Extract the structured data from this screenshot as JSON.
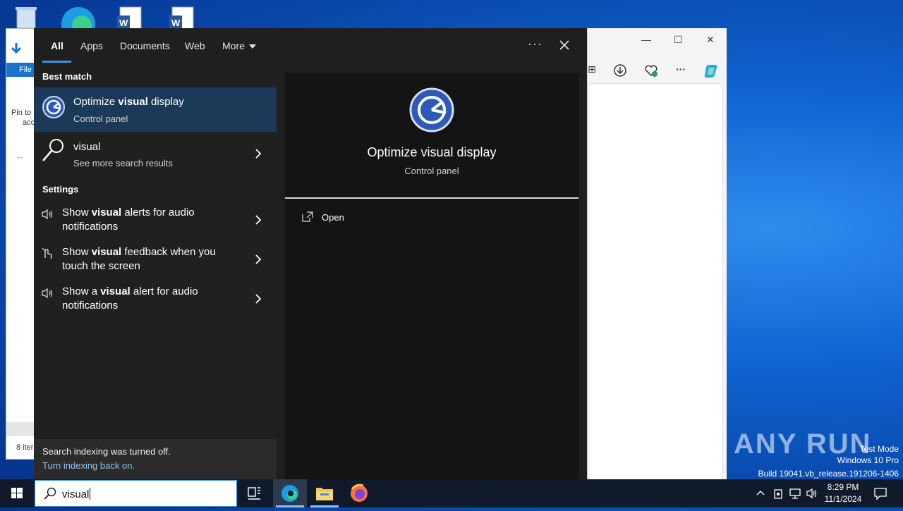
{
  "search_panel": {
    "tabs": [
      {
        "label": "All"
      },
      {
        "label": "Apps"
      },
      {
        "label": "Documents"
      },
      {
        "label": "Web"
      },
      {
        "label": "More"
      }
    ],
    "more_options": "···",
    "best_match_header": "Best match",
    "best_match": {
      "pre": "Optimize ",
      "bold": "visual",
      "post": " display",
      "subtitle": "Control panel",
      "icon": "ease-of-access-icon"
    },
    "web_result": {
      "title": "visual",
      "subtitle": "See more search results",
      "icon": "search-icon"
    },
    "settings_header": "Settings",
    "settings": [
      {
        "pre": "Show ",
        "bold": "visual",
        "line1_post": " alerts for audio",
        "line2": "notifications",
        "icon": "speaker-icon"
      },
      {
        "pre": "Show ",
        "bold": "visual",
        "line1_post": " feedback when you",
        "line2": "touch the screen",
        "icon": "touch-icon"
      },
      {
        "pre": "Show a ",
        "bold": "visual",
        "line1_post": " alert for audio",
        "line2": "notifications",
        "icon": "speaker-icon"
      }
    ],
    "footer": {
      "line1": "Search indexing was turned off.",
      "line2": "Turn indexing back on."
    },
    "preview": {
      "title": "Optimize visual display",
      "subtitle": "Control panel",
      "open_label": "Open"
    }
  },
  "taskbar": {
    "search_value": "visual",
    "time": "8:29 PM",
    "date": "11/1/2024"
  },
  "explorer_bg": {
    "file_tab": "File",
    "pin_line1": "Pin to",
    "pin_line2": "acc",
    "status": "8 iter"
  },
  "watermark": {
    "brand": "ANY RUN",
    "line1": "Test Mode",
    "line2": "Windows 10 Pro",
    "line3": "Build 19041.vb_release.191206-1406"
  },
  "colors": {
    "accent": "#3a96dd",
    "selected_bg": "#1c3a58",
    "link": "#8ec3f0"
  }
}
